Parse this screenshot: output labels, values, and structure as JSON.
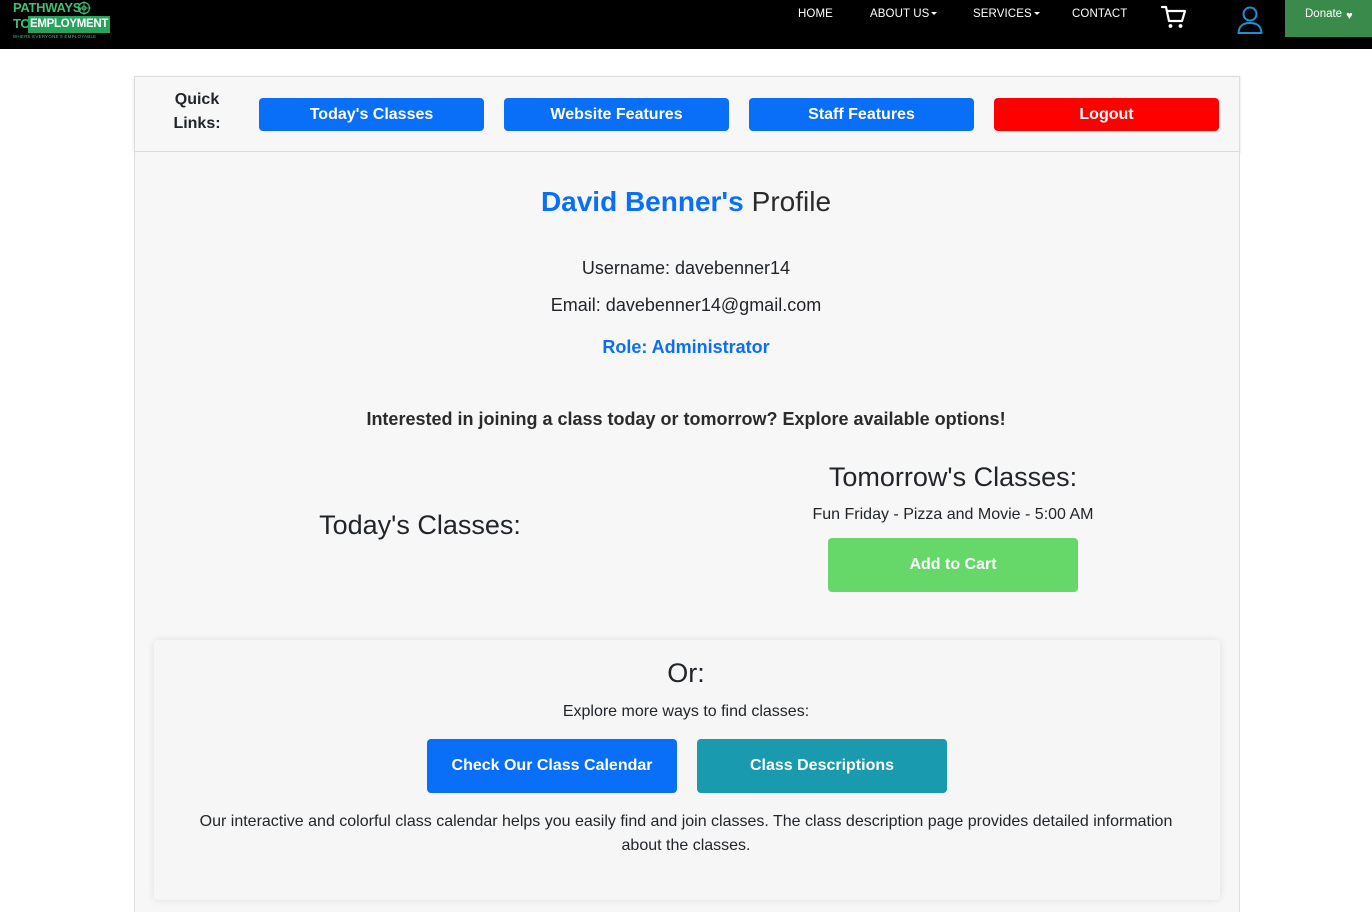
{
  "brand": {
    "line1": "PATHWAYS",
    "line2_to": "TO",
    "line2_emp": "EMPLOYMENT",
    "tagline": "WHERE EVERYONE'S EMPLOYABLE"
  },
  "nav": {
    "home": "HOME",
    "about": "ABOUT US",
    "services": "SERVICES",
    "contact": "CONTACT",
    "donate": "Donate",
    "icons": [
      "cart-icon",
      "user-icon",
      "heart-icon"
    ]
  },
  "quick_links": {
    "label": "Quick Links:",
    "buttons": [
      "Today's Classes",
      "Website Features",
      "Staff Features",
      "Logout"
    ]
  },
  "profile": {
    "name": "David Benner's",
    "title_word": "Profile",
    "username": "Username: davebenner14",
    "email": "Email: davebenner14@gmail.com",
    "role": "Role: Administrator"
  },
  "classes": {
    "prompt": "Interested in joining a class today or tomorrow? Explore available options!",
    "today_heading": "Today's Classes:",
    "tomorrow_heading": "Tomorrow's Classes:",
    "tomorrow_items": [
      "Fun Friday - Pizza and Movie - 5:00 AM"
    ],
    "add_to_cart": "Add to Cart"
  },
  "or_section": {
    "heading": "Or:",
    "subtext": "Explore more ways to find classes:",
    "calendar_button": "Check Our Class Calendar",
    "descriptions_button": "Class Descriptions",
    "description": "Our interactive and colorful class calendar helps you easily find and join classes. The class description page provides detailed information about the classes."
  },
  "colors": {
    "primary_blue": "#0a6ff8",
    "logout_red": "#ff0000",
    "add_cart_green": "#66d86a",
    "teal": "#1a9aae",
    "donate_green": "#3a8a4c",
    "brand_green": "#3fbf73"
  }
}
